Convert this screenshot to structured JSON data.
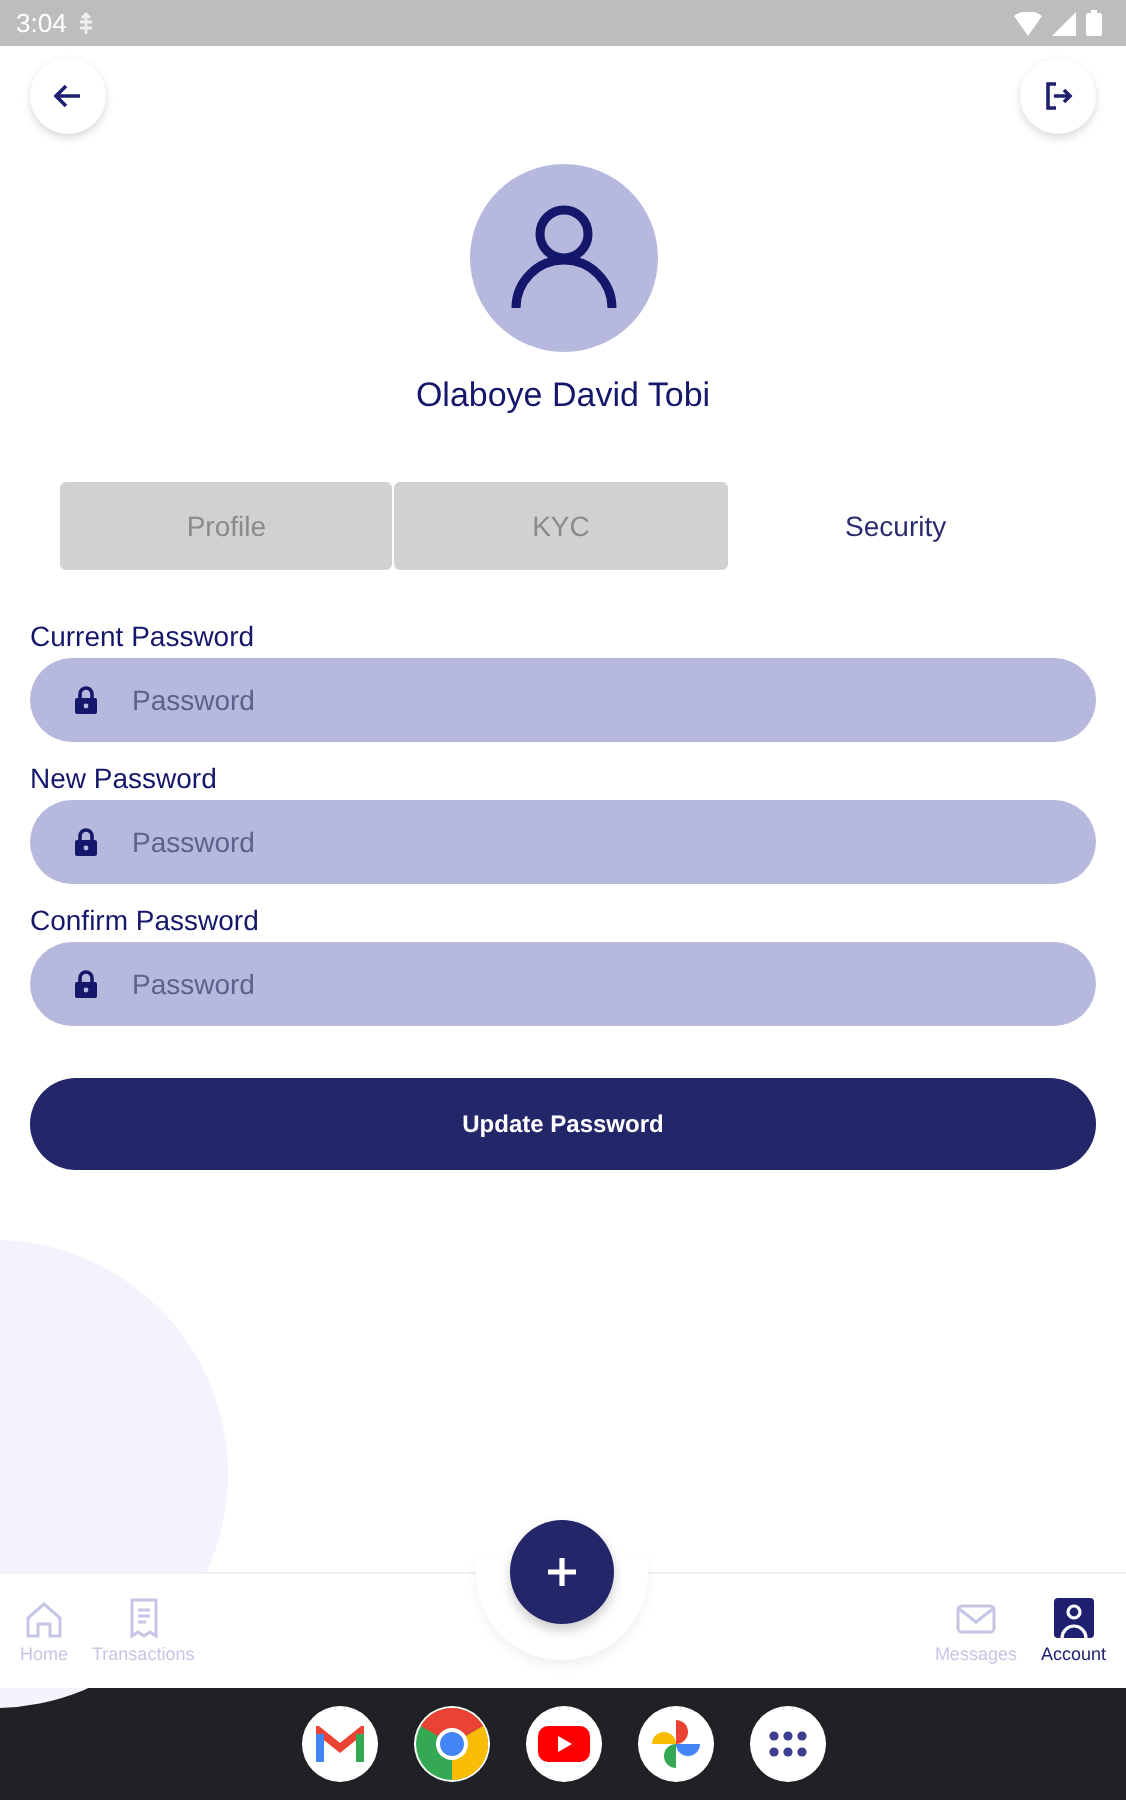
{
  "status_bar": {
    "time": "3:04"
  },
  "profile": {
    "name": "Olaboye David Tobi"
  },
  "tabs": [
    {
      "label": "Profile",
      "selected": false
    },
    {
      "label": "KYC",
      "selected": false
    },
    {
      "label": "Security",
      "selected": true
    }
  ],
  "fields": [
    {
      "label": "Current Password",
      "placeholder": "Password"
    },
    {
      "label": "New Password",
      "placeholder": "Password"
    },
    {
      "label": "Confirm Password",
      "placeholder": "Password"
    }
  ],
  "submit_button": "Update Password",
  "nav": [
    {
      "label": "Home",
      "kind": "home",
      "selected": false
    },
    {
      "label": "Transactions",
      "kind": "receipt",
      "selected": false
    },
    {
      "label": "Messages",
      "kind": "mail",
      "selected": false
    },
    {
      "label": "Account",
      "kind": "account",
      "selected": true
    }
  ]
}
